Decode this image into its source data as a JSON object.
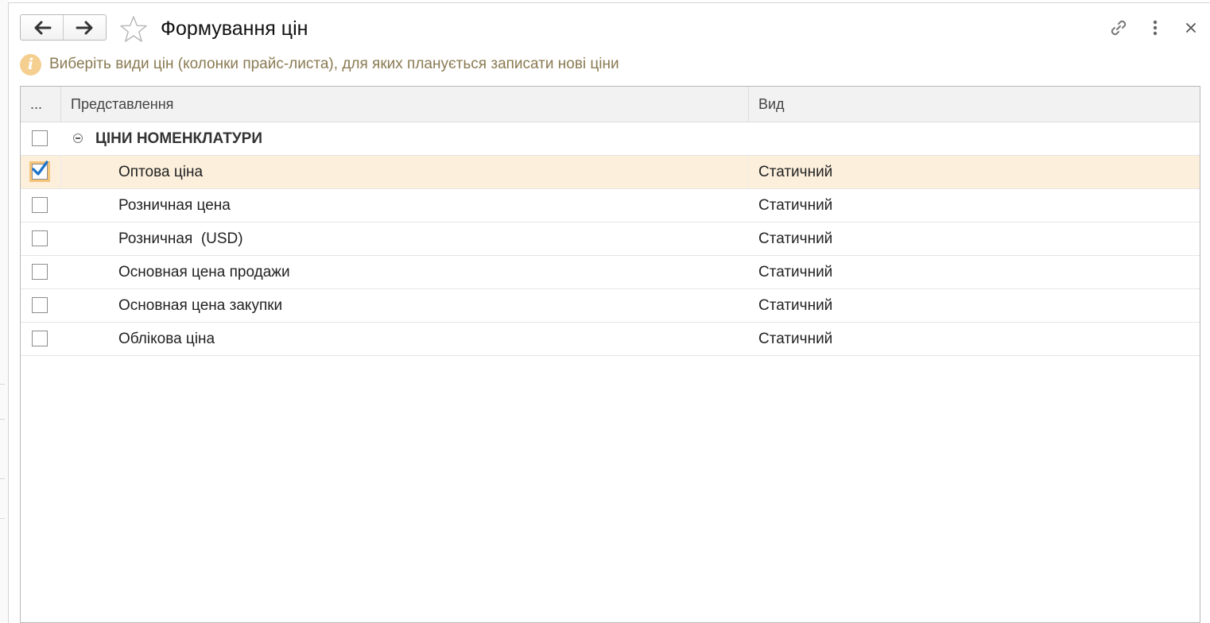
{
  "window": {
    "title": "Формування цін"
  },
  "header": {
    "back_icon": "arrow-left-icon",
    "forward_icon": "arrow-right-icon",
    "favorite_icon": "star-outline-icon",
    "link_icon": "link-icon",
    "more_icon": "more-vertical-icon",
    "close_icon": "close-icon"
  },
  "info": {
    "icon": "info-icon",
    "icon_glyph": "i",
    "text": "Виберіть види цін (колонки прайс-листа), для яких планується записати нові ціни"
  },
  "table": {
    "columns": {
      "check": "...",
      "name": "Представлення",
      "kind": "Вид"
    },
    "group": {
      "title": "ЦІНИ НОМЕНКЛАТУРИ",
      "checked": false,
      "expanded": true
    },
    "rows": [
      {
        "name": "Оптова ціна",
        "kind": "Статичний",
        "checked": true,
        "selected": true
      },
      {
        "name": "Розничная цена",
        "kind": "Статичний",
        "checked": false,
        "selected": false
      },
      {
        "name": "Розничная  (USD)",
        "kind": "Статичний",
        "checked": false,
        "selected": false
      },
      {
        "name": "Основная цена продажи",
        "kind": "Статичний",
        "checked": false,
        "selected": false
      },
      {
        "name": "Основная цена закупки",
        "kind": "Статичний",
        "checked": false,
        "selected": false
      },
      {
        "name": "Облікова ціна",
        "kind": "Статичний",
        "checked": false,
        "selected": false
      }
    ]
  },
  "colors": {
    "selected_row": "#fcefdc",
    "focus_border": "#f4c47a",
    "checkmark": "#1a73c8",
    "info_icon_bg": "#f4cf90",
    "info_text": "#8a7a52"
  }
}
